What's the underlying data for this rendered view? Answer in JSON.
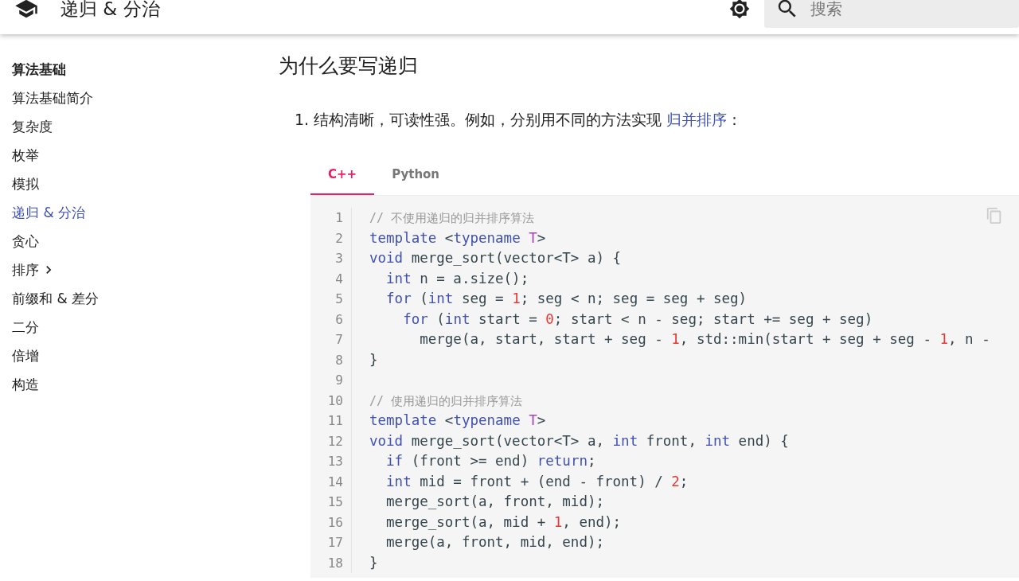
{
  "header": {
    "title": "递归 & 分治",
    "search": {
      "placeholder": "搜索"
    }
  },
  "sidebar": {
    "items": [
      {
        "label": "算法基础",
        "kind": "heading",
        "selected": false
      },
      {
        "label": "算法基础简介",
        "kind": "link",
        "selected": false
      },
      {
        "label": "复杂度",
        "kind": "link",
        "selected": false
      },
      {
        "label": "枚举",
        "kind": "link",
        "selected": false
      },
      {
        "label": "模拟",
        "kind": "link",
        "selected": false
      },
      {
        "label": "递归 & 分治",
        "kind": "link",
        "selected": true
      },
      {
        "label": "贪心",
        "kind": "link",
        "selected": false
      },
      {
        "label": "排序",
        "kind": "group",
        "selected": false,
        "expanded": false
      },
      {
        "label": "前缀和 & 差分",
        "kind": "link",
        "selected": false
      },
      {
        "label": "二分",
        "kind": "link",
        "selected": false
      },
      {
        "label": "倍增",
        "kind": "link",
        "selected": false
      },
      {
        "label": "构造",
        "kind": "link",
        "selected": false
      }
    ]
  },
  "content": {
    "heading": "为什么要写递归",
    "list": [
      {
        "marker": "1.",
        "text": "结构清晰，可读性强。例如，分别用不同的方法实现 ",
        "link": "归并排序",
        "after": "："
      }
    ],
    "tabs": [
      {
        "label": "C++",
        "selected": true
      },
      {
        "label": "Python",
        "selected": false
      }
    ],
    "code": [
      {
        "number": "1",
        "tokens": [
          {
            "comment": "// 不使用递归的归并排序算法"
          }
        ]
      },
      {
        "number": "2",
        "tokens": [
          {
            "kw": "template"
          },
          {
            "plain": " <"
          },
          {
            "kw": "typename"
          },
          {
            "type": " T"
          },
          {
            "plain": ">"
          }
        ]
      },
      {
        "number": "3",
        "tokens": [
          {
            "kw": "void"
          },
          {
            "plain": " merge_sort(vector<T> a) {"
          }
        ]
      },
      {
        "number": "4",
        "tokens": [
          {
            "kw": "  int"
          },
          {
            "plain": " n = a.size();"
          }
        ]
      },
      {
        "number": "5",
        "tokens": [
          {
            "kw": "  for"
          },
          {
            "plain": " ("
          },
          {
            "kw": "int"
          },
          {
            "plain": " seg = "
          },
          {
            "num": "1"
          },
          {
            "plain": "; seg < n; seg = seg + seg)"
          }
        ]
      },
      {
        "number": "6",
        "tokens": [
          {
            "kw": "    for"
          },
          {
            "plain": " ("
          },
          {
            "kw": "int"
          },
          {
            "plain": " start = "
          },
          {
            "num": "0"
          },
          {
            "plain": "; start < n - seg; start += seg + seg)"
          }
        ]
      },
      {
        "number": "7",
        "tokens": [
          {
            "plain": "      merge(a, start, start + seg - "
          },
          {
            "num": "1"
          },
          {
            "plain": ", std::min(start + seg + seg - "
          },
          {
            "num": "1"
          },
          {
            "plain": ", n -"
          }
        ]
      },
      {
        "number": "8",
        "tokens": [
          {
            "plain": "}"
          }
        ]
      },
      {
        "number": "9"
      },
      {
        "number": "10",
        "tokens": [
          {
            "comment": "// 使用递归的归并排序算法"
          }
        ]
      },
      {
        "number": "11",
        "tokens": [
          {
            "kw": "template"
          },
          {
            "plain": " <"
          },
          {
            "kw": "typename"
          },
          {
            "type": " T"
          },
          {
            "plain": ">"
          }
        ]
      },
      {
        "number": "12",
        "tokens": [
          {
            "kw": "void"
          },
          {
            "plain": " merge_sort(vector<T> a, "
          },
          {
            "kw": "int"
          },
          {
            "plain": " front, "
          },
          {
            "kw": "int"
          },
          {
            "plain": " end) {"
          }
        ]
      },
      {
        "number": "13",
        "tokens": [
          {
            "kw": "  if"
          },
          {
            "plain": " (front >= end) "
          },
          {
            "kw": "return"
          },
          {
            "plain": ";"
          }
        ]
      },
      {
        "number": "14",
        "tokens": [
          {
            "kw": "  int"
          },
          {
            "plain": " mid = front + (end - front) / "
          },
          {
            "num": "2"
          },
          {
            "plain": ";"
          }
        ]
      },
      {
        "number": "15",
        "tokens": [
          {
            "plain": "  merge_sort(a, front, mid);"
          }
        ]
      },
      {
        "number": "16",
        "tokens": [
          {
            "plain": "  merge_sort(a, mid + "
          },
          {
            "num": "1"
          },
          {
            "plain": ", end);"
          }
        ]
      },
      {
        "number": "17",
        "tokens": [
          {
            "plain": "  merge(a, front, mid, end);"
          }
        ]
      },
      {
        "number": "18",
        "tokens": [
          {
            "plain": "}"
          }
        ]
      }
    ]
  }
}
